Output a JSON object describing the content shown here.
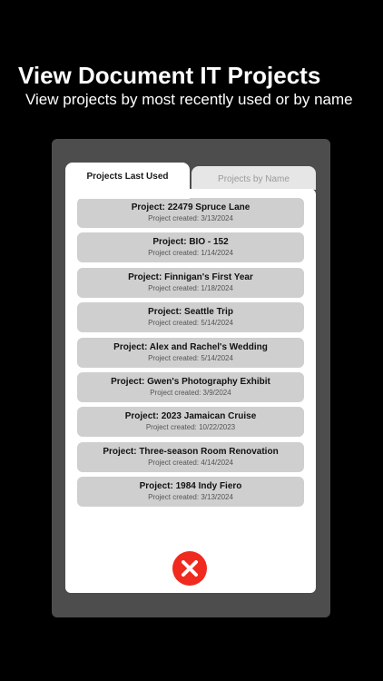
{
  "header": {
    "title": "View Document IT Projects",
    "subtitle": "View projects by most recently used or by name"
  },
  "tabs": [
    {
      "label": "Projects Last Used",
      "active": true
    },
    {
      "label": "Projects by Name",
      "active": false
    }
  ],
  "projects": [
    {
      "title": "Project: 22479 Spruce Lane",
      "created": "Project created: 3/13/2024"
    },
    {
      "title": "Project: BIO - 152",
      "created": "Project created: 1/14/2024"
    },
    {
      "title": "Project: Finnigan's First Year",
      "created": "Project created: 1/18/2024"
    },
    {
      "title": "Project: Seattle Trip",
      "created": "Project created: 5/14/2024"
    },
    {
      "title": "Project: Alex and Rachel's Wedding",
      "created": "Project created: 5/14/2024"
    },
    {
      "title": "Project: Gwen's Photography Exhibit",
      "created": "Project created: 3/9/2024"
    },
    {
      "title": "Project: 2023 Jamaican Cruise",
      "created": "Project created: 10/22/2023"
    },
    {
      "title": "Project: Three-season Room Renovation",
      "created": "Project created: 4/14/2024"
    },
    {
      "title": "Project: 1984 Indy Fiero",
      "created": "Project created: 3/13/2024"
    }
  ],
  "close_button": {
    "icon": "close-icon",
    "color": "#f02a1e"
  },
  "colors": {
    "background": "#000000",
    "device_frame": "#4d4d4d",
    "list_item": "#cfcfcf"
  }
}
